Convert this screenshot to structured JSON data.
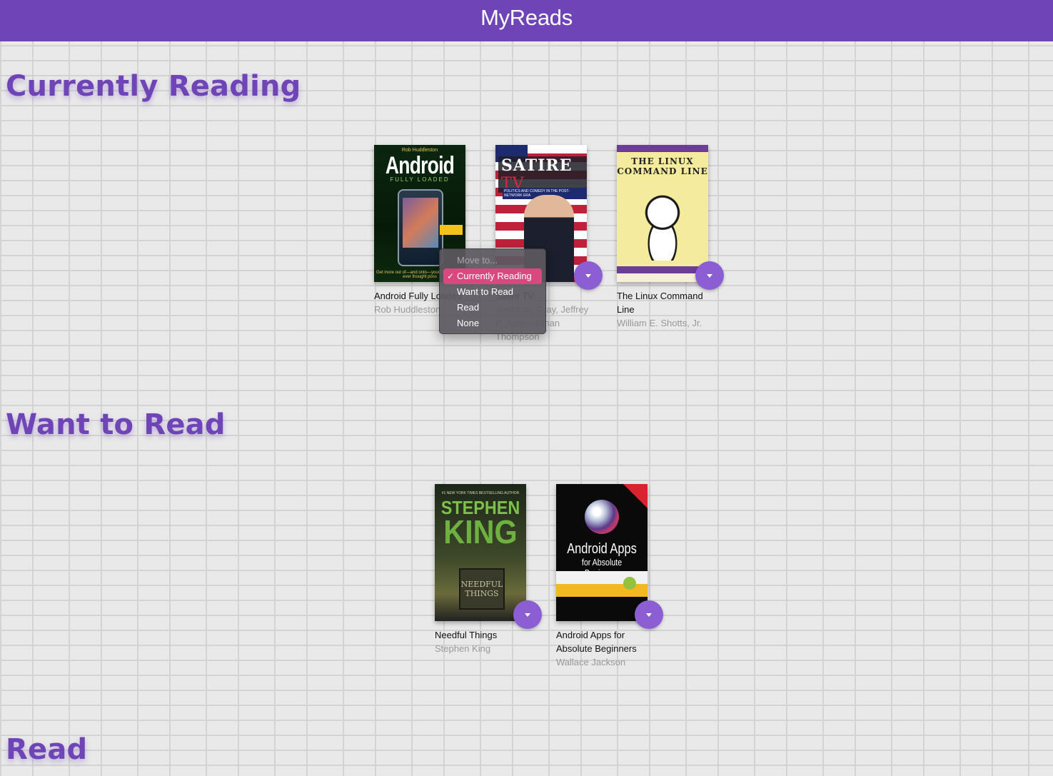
{
  "app": {
    "title": "MyReads"
  },
  "shelves": [
    {
      "title": "Currently Reading",
      "books": [
        {
          "title": "Android Fully Loaded",
          "authors": "Rob Huddleston"
        },
        {
          "title": "Satire TV",
          "authors": "Jonathan Gray, Jeffrey P. Jones, Ethan Thompson"
        },
        {
          "title": "The Linux Command Line",
          "authors": "William E. Shotts, Jr."
        }
      ]
    },
    {
      "title": "Want to Read",
      "books": [
        {
          "title": "Needful Things",
          "authors": "Stephen King"
        },
        {
          "title": "Android Apps for Absolute Beginners",
          "authors": "Wallace Jackson"
        }
      ]
    },
    {
      "title": "Read",
      "books": []
    }
  ],
  "shelf_menu": {
    "header": "Move to...",
    "options": [
      "Currently Reading",
      "Want to Read",
      "Read",
      "None"
    ],
    "selected": "Currently Reading"
  },
  "covers": {
    "android": {
      "author": "Rob Huddleston",
      "title": "Android",
      "subtitle": "FULLY LOADED",
      "foot": "Get more out of—and onto—your An than you ever thought poss"
    },
    "satire": {
      "title_main": "SATIRE",
      "title_accent": "TV",
      "subtitle": "POLITICS AND COMEDY IN THE POST-NETWORK ERA"
    },
    "linux": {
      "title_line1": "THE LINUX",
      "title_line2": "COMMAND LINE"
    },
    "king": {
      "tagline": "#1 NEW YORK TIMES BESTSELLING AUTHOR",
      "name1": "STEPHEN",
      "name2": "KING",
      "sign_line1": "NEEDFUL",
      "sign_line2": "THINGS"
    },
    "apps": {
      "title": "Android Apps",
      "subtitle": "for Absolute Beginners"
    }
  },
  "colors": {
    "header": "#6e44b6",
    "shelf_title": "#6e44b6",
    "changer": "#8b5fd3",
    "menu_selected": "#d9497f"
  }
}
